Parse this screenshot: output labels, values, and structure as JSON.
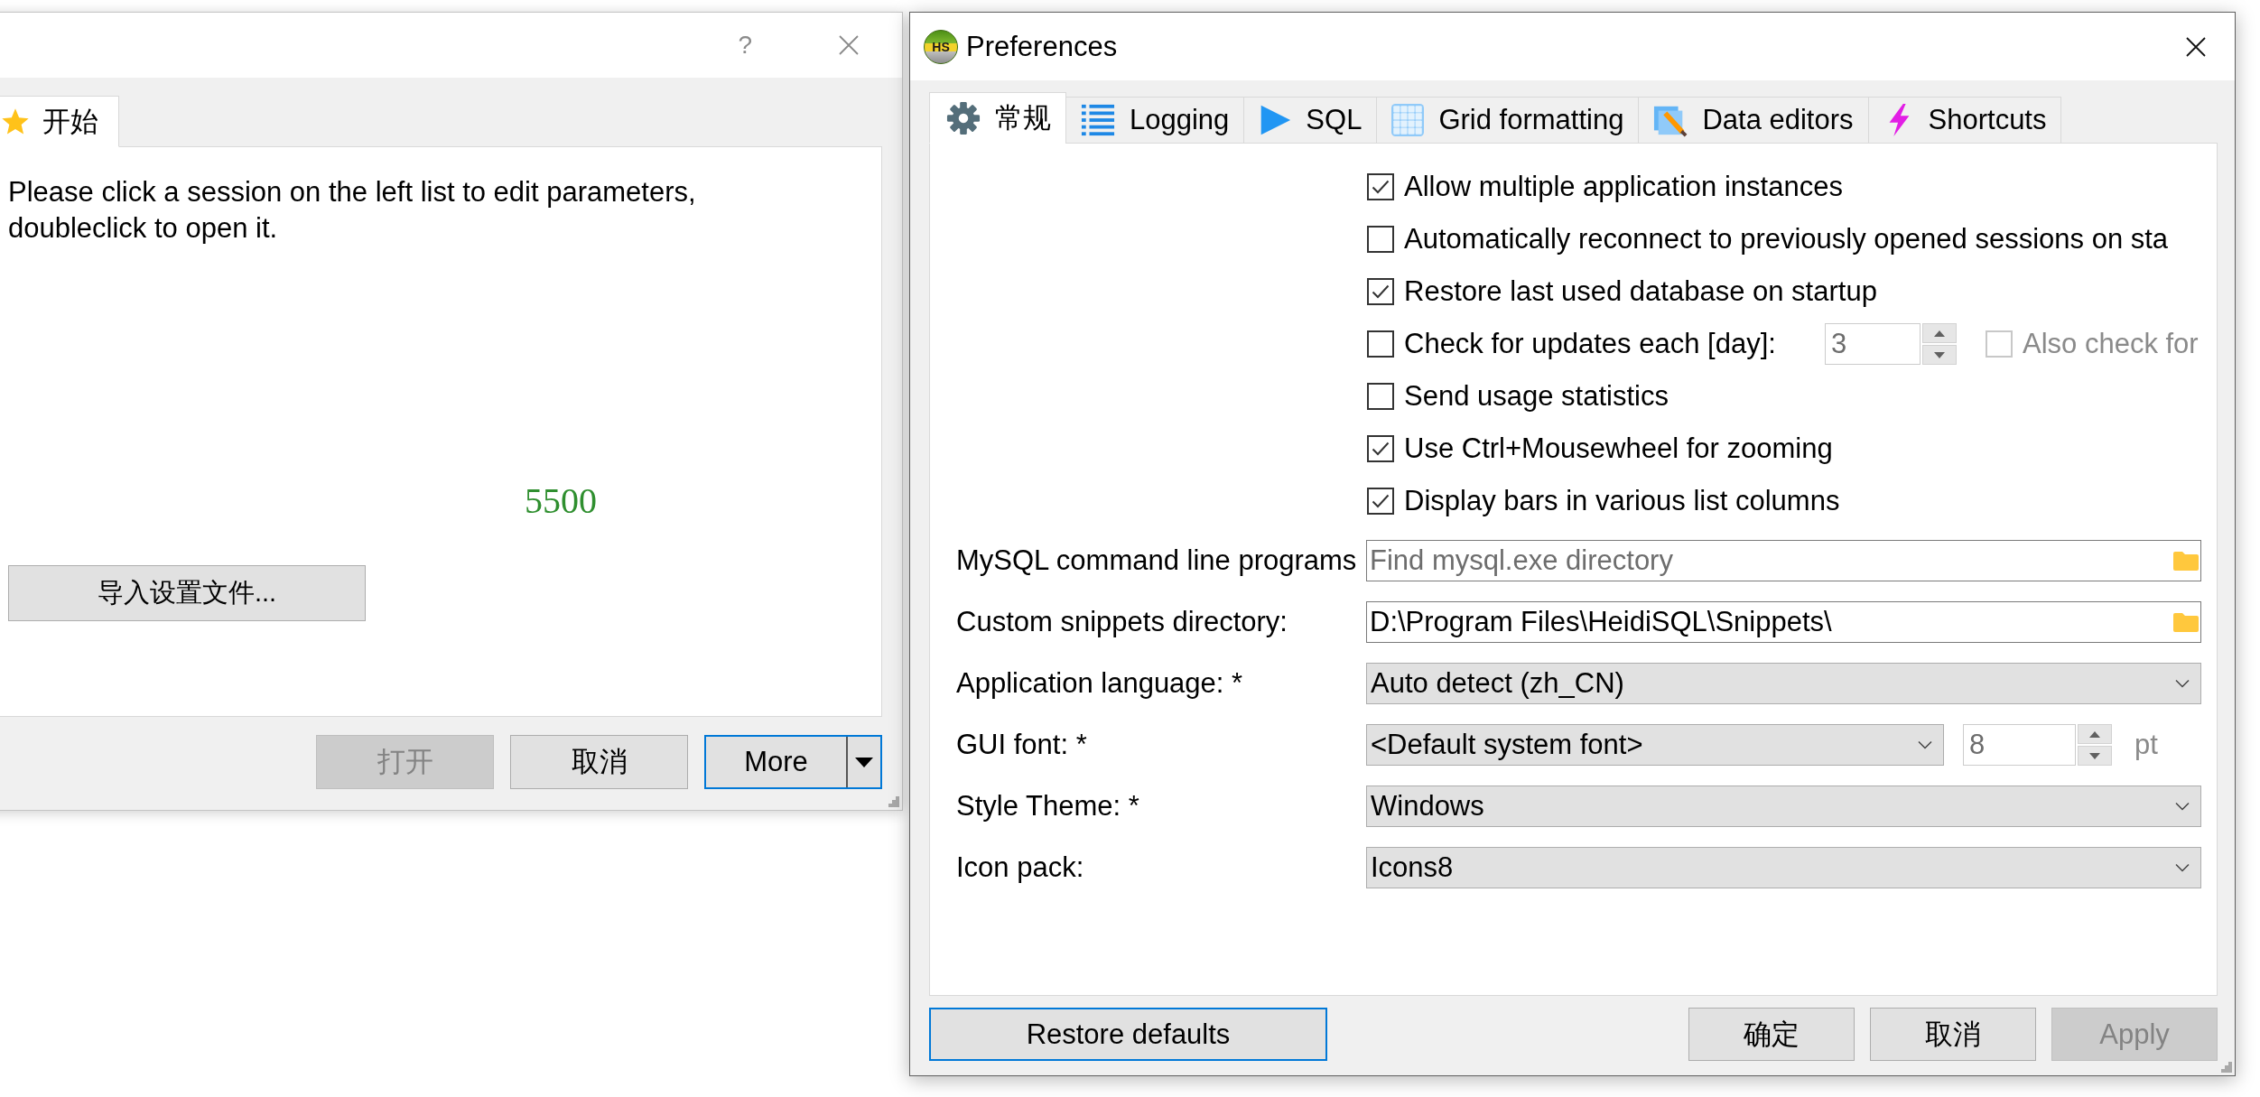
{
  "session_dialog": {
    "help_button": "?",
    "tabs": [
      {
        "label": "开始",
        "selected": true
      }
    ],
    "message": "Please click a session on the left list to edit parameters, doubleclick to open it.",
    "port": "5500",
    "import_button": "导入设置文件...",
    "buttons": [
      {
        "kind": "push",
        "label": "打开",
        "disabled": true,
        "focused": false
      },
      {
        "kind": "push",
        "label": "取消",
        "disabled": false,
        "focused": false
      },
      {
        "kind": "split",
        "label": "More",
        "disabled": false,
        "focused": true
      }
    ]
  },
  "preferences": {
    "logo": "HS",
    "title": "Preferences",
    "tabs": [
      {
        "label": "常规",
        "selected": true
      },
      {
        "label": "Logging",
        "selected": false
      },
      {
        "label": "SQL",
        "selected": false
      },
      {
        "label": "Grid formatting",
        "selected": false
      },
      {
        "label": "Data editors",
        "selected": false
      },
      {
        "label": "Shortcuts",
        "selected": false
      }
    ],
    "options": [
      {
        "kind": "check",
        "label": "Allow multiple application instances",
        "checked": true
      },
      {
        "kind": "check",
        "label": "Automatically reconnect to previously opened sessions on sta",
        "checked": false
      },
      {
        "kind": "check",
        "label": "Restore last used database on startup",
        "checked": true
      },
      {
        "kind": "check_spin",
        "label": "Check for updates each [day]:",
        "checked": false,
        "spin": {
          "value": "3",
          "disabled": true
        },
        "extra": {
          "label": "Also check for",
          "checked": false,
          "disabled": true
        }
      },
      {
        "kind": "check",
        "label": "Send usage statistics",
        "checked": false
      },
      {
        "kind": "check",
        "label": "Use Ctrl+Mousewheel for zooming",
        "checked": true
      },
      {
        "kind": "check",
        "label": "Display bars in various list columns",
        "checked": true
      }
    ],
    "fields": [
      {
        "kind": "path",
        "label": "MySQL command line programs",
        "placeholder": "Find mysql.exe directory"
      },
      {
        "kind": "path",
        "label": "Custom snippets directory:",
        "value": "D:\\Program Files\\HeidiSQL\\Snippets\\"
      },
      {
        "kind": "combo",
        "label": "Application language: *",
        "value": "Auto detect (zh_CN)"
      },
      {
        "kind": "combo_spin",
        "label": "GUI font: *",
        "value": "<Default system font>",
        "size": {
          "value": "8",
          "disabled": true
        },
        "unit": "pt"
      },
      {
        "kind": "combo",
        "label": "Style Theme: *",
        "value": "Windows"
      },
      {
        "kind": "combo",
        "label": "Icon pack:",
        "value": "Icons8"
      }
    ],
    "restore_button": {
      "label": "Restore defaults",
      "focused": true
    },
    "buttons": [
      {
        "label": "确定",
        "disabled": false,
        "focused": false
      },
      {
        "label": "取消",
        "disabled": false,
        "focused": false
      },
      {
        "label": "Apply",
        "disabled": true,
        "focused": false
      }
    ]
  }
}
